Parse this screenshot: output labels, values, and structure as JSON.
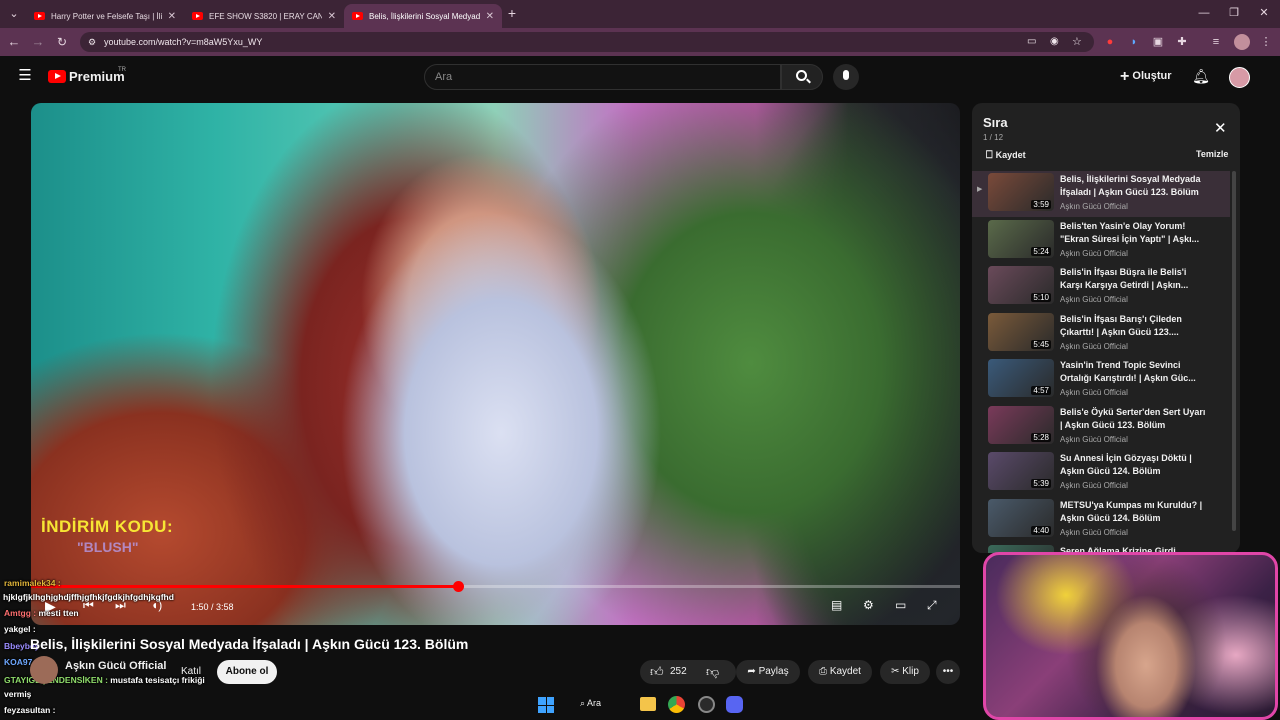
{
  "browser": {
    "tabs": [
      {
        "label": "Harry Potter ve Felsefe Taşı | İli",
        "active": false
      },
      {
        "label": "EFE SHOW S3820 | ERAY CAN C",
        "active": false
      },
      {
        "label": "Belis, İlişkilerini Sosyal Medyada",
        "active": true
      }
    ],
    "url": "youtube.com/watch?v=m8aW5Yxu_WY"
  },
  "youtube": {
    "logo": "Premium",
    "region": "TR",
    "search_placeholder": "Ara",
    "create_label": "Oluştur"
  },
  "video": {
    "promo_line1": "İNDİRİM KODU:",
    "promo_line2": "\"BLUSH\"",
    "time": "1:50 / 3:58",
    "progress": 0.46,
    "title": "Belis, İlişkilerini Sosyal Medyada İfşaladı | Aşkın Gücü 123. Bölüm"
  },
  "channel": {
    "name": "Aşkın Gücü Official",
    "join_label": "Katıl",
    "subscribe_label": "Abone ol"
  },
  "actions": {
    "likes": "252",
    "share": "Paylaş",
    "save": "Kaydet",
    "clip": "Klip"
  },
  "chat": [
    {
      "user": "ramimalek34 :",
      "msg": "",
      "color": "#e0b53a"
    },
    {
      "user": "",
      "msg": "hjklgfjklhghjghdjffhjgfhkjfgdkjhfgdhjkgfhd",
      "color": "#ffffff"
    },
    {
      "user": "Amtgg :",
      "msg": " mesti tten",
      "color": "#ff7070"
    },
    {
      "user": "yakgel :",
      "msg": "",
      "color": "#ffffff"
    },
    {
      "user": "Bbeybey :",
      "msg": "",
      "color": "#9b8cff"
    },
    {
      "user": "KOA97 :",
      "msg": "",
      "color": "#6fa8ff"
    },
    {
      "user": "GTAYIGEÇENDENSİKEN :",
      "msg": " mustafa tesisatçı frikiği",
      "color": "#8fdc6b"
    },
    {
      "user": "",
      "msg": "vermiş",
      "color": "#ffffff"
    },
    {
      "user": "feyzasultan :",
      "msg": "",
      "color": "#ffffff"
    }
  ],
  "playlist": {
    "title": "Sıra",
    "count": "1 / 12",
    "save_label": "Kaydet",
    "clear_label": "Temizle",
    "items": [
      {
        "title": "Belis, İlişkilerini Sosyal Medyada İfşaladı | Aşkın Gücü 123. Bölüm",
        "channel": "Aşkın Gücü Official",
        "duration": "3:59",
        "active": true,
        "color": "#7a4a3a"
      },
      {
        "title": "Belis'ten Yasin'e Olay Yorum! \"Ekran Süresi İçin Yaptı\" | Aşkı...",
        "channel": "Aşkın Gücü Official",
        "duration": "5:24",
        "active": false,
        "color": "#5a6a4a"
      },
      {
        "title": "Belis'in İfşası Büşra ile Belis'i Karşı Karşıya Getirdi | Aşkın...",
        "channel": "Aşkın Gücü Official",
        "duration": "5:10",
        "active": false,
        "color": "#6a4a5a"
      },
      {
        "title": "Belis'in İfşası Barış'ı Çileden Çıkarttı! | Aşkın Gücü 123....",
        "channel": "Aşkın Gücü Official",
        "duration": "5:45",
        "active": false,
        "color": "#7a5a3a"
      },
      {
        "title": "Yasin'in Trend Topic Sevinci Ortalığı Karıştırdı! | Aşkın Güc...",
        "channel": "Aşkın Gücü Official",
        "duration": "4:57",
        "active": false,
        "color": "#3a5a7a"
      },
      {
        "title": "Belis'e Öykü Serter'den Sert Uyarı | Aşkın Gücü 123. Bölüm",
        "channel": "Aşkın Gücü Official",
        "duration": "5:28",
        "active": false,
        "color": "#7a3a5a"
      },
      {
        "title": "Su Annesi İçin Gözyaşı Döktü | Aşkın Gücü 124. Bölüm",
        "channel": "Aşkın Gücü Official",
        "duration": "5:39",
        "active": false,
        "color": "#5a4a6a"
      },
      {
        "title": "METSU'ya Kumpas mı Kuruldu? | Aşkın Gücü 124. Bölüm",
        "channel": "Aşkın Gücü Official",
        "duration": "4:40",
        "active": false,
        "color": "#4a5a6a"
      },
      {
        "title": "Seren Ağlama Krizine Girdi",
        "channel": "",
        "duration": "",
        "active": false,
        "color": "#3a6a5a"
      }
    ]
  },
  "taskbar": {
    "search_label": "Ara"
  }
}
